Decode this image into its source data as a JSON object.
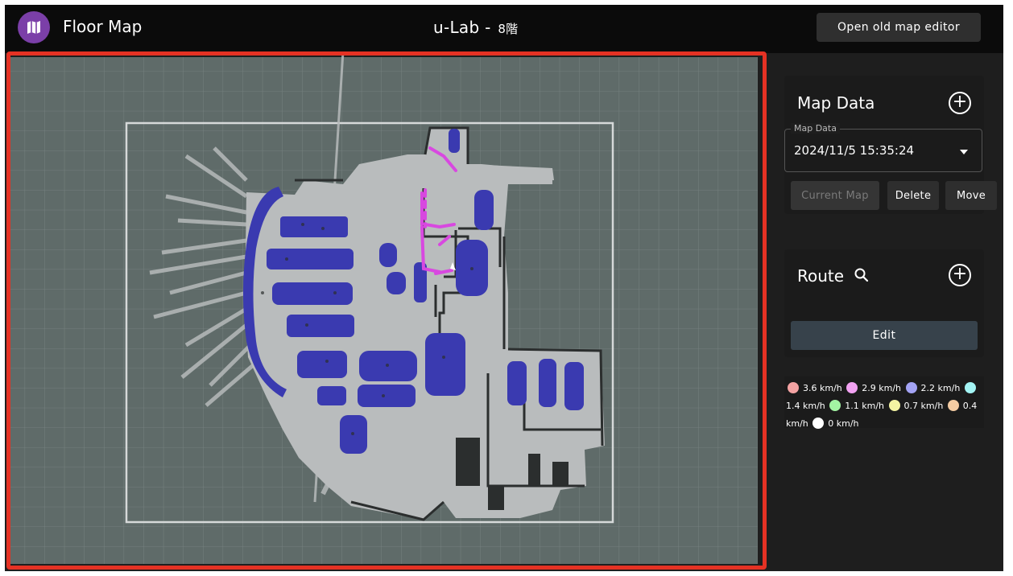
{
  "header": {
    "app_title": "Floor Map",
    "location": "u-Lab - ",
    "floor": "8階",
    "old_editor_label": "Open old map editor",
    "logo_icon": "map-icon",
    "logo_color": "#7b3fa8"
  },
  "map_panel": {
    "title": "Map Data",
    "select_label": "Map Data",
    "selected_value": "2024/11/5 15:35:24",
    "buttons": {
      "current_map": "Current Map",
      "delete": "Delete",
      "move": "Move"
    }
  },
  "route_panel": {
    "title": "Route",
    "edit_label": "Edit"
  },
  "legend": [
    {
      "label": "3.6 km/h",
      "color": "#f4a3a3"
    },
    {
      "label": "2.9 km/h",
      "color": "#f2a2f2"
    },
    {
      "label": "2.2 km/h",
      "color": "#a3a3f4"
    },
    {
      "label": "1.4 km/h",
      "color": "#a3f4f4"
    },
    {
      "label": "1.1 km/h",
      "color": "#a3f4a3"
    },
    {
      "label": "0.7 km/h",
      "color": "#f4f4a3"
    },
    {
      "label": "0.4 km/h",
      "color": "#f4cca3"
    },
    {
      "label": "0 km/h",
      "color": "#ffffff"
    }
  ],
  "colors": {
    "accent_border": "#e53224",
    "map_background": "#5f6b69",
    "floor": "#b9bcbd",
    "zones": "#3a3ab0",
    "route_path": "#d848e0"
  }
}
